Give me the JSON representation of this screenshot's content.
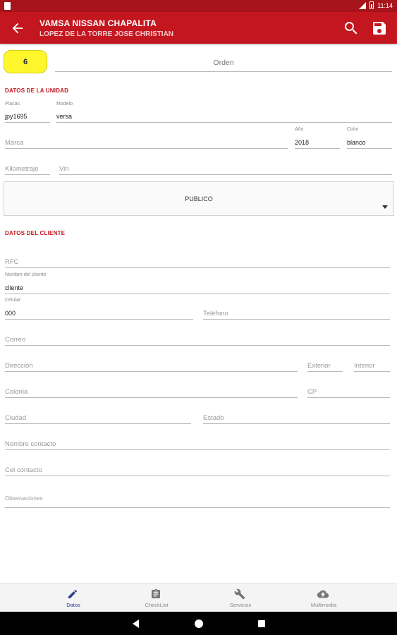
{
  "status_bar": {
    "time": "11:14"
  },
  "app_bar": {
    "title": "VAMSA NISSAN CHAPALITA",
    "subtitle": "LOPEZ DE LA TORRE JOSE CHRISTIAN",
    "icons": [
      "back-arrow-icon",
      "search-icon",
      "save-icon"
    ]
  },
  "order": {
    "number": "6",
    "orden_placeholder": "Orden"
  },
  "unit_section": {
    "heading": "DATOS DE LA UNIDAD",
    "placas": {
      "label": "Placas",
      "value": "jpy1695"
    },
    "modelo": {
      "label": "Modelo",
      "value": "versa"
    },
    "marca": {
      "placeholder": "Marca"
    },
    "anio": {
      "label": "Año",
      "value": "2018"
    },
    "color": {
      "label": "Color",
      "value": "blanco"
    },
    "kilometraje": {
      "placeholder": "Kilometraje"
    },
    "vin": {
      "placeholder": "Vin"
    },
    "tipo": {
      "selected": "PUBLICO"
    }
  },
  "client_section": {
    "heading": "DATOS DEL CLIENTE",
    "rfc": {
      "placeholder": "RFC"
    },
    "nombre": {
      "label": "Nombre del cliente",
      "value": "cliente"
    },
    "celular": {
      "label": "Celular",
      "value": "000"
    },
    "telefono": {
      "placeholder": "Teléfono"
    },
    "correo": {
      "placeholder": "Correo"
    },
    "direccion": {
      "placeholder": "Dirección"
    },
    "exterior": {
      "placeholder": "Exterior"
    },
    "interior": {
      "placeholder": "Interior"
    },
    "colonia": {
      "placeholder": "Colonia"
    },
    "cp": {
      "placeholder": "CP"
    },
    "ciudad": {
      "placeholder": "Ciudad"
    },
    "estado": {
      "placeholder": "Estado"
    },
    "nombre_contacto": {
      "placeholder": "Nombre contacto"
    },
    "cel_contacto": {
      "placeholder": "Cel contacto"
    },
    "observaciones": {
      "placeholder": "Observaciones"
    }
  },
  "bottom_nav": {
    "items": [
      {
        "label": "Datos",
        "icon": "pencil-icon",
        "active": true
      },
      {
        "label": "CheckList",
        "icon": "clipboard-icon",
        "active": false
      },
      {
        "label": "Servicios",
        "icon": "wrench-icon",
        "active": false
      },
      {
        "label": "Multimedia",
        "icon": "cloud-upload-icon",
        "active": false
      }
    ]
  },
  "colors": {
    "primary": "#c4161f",
    "primary_dark": "#a8141b",
    "badge": "#fdf62b",
    "nav_active": "#2a3d8f"
  }
}
